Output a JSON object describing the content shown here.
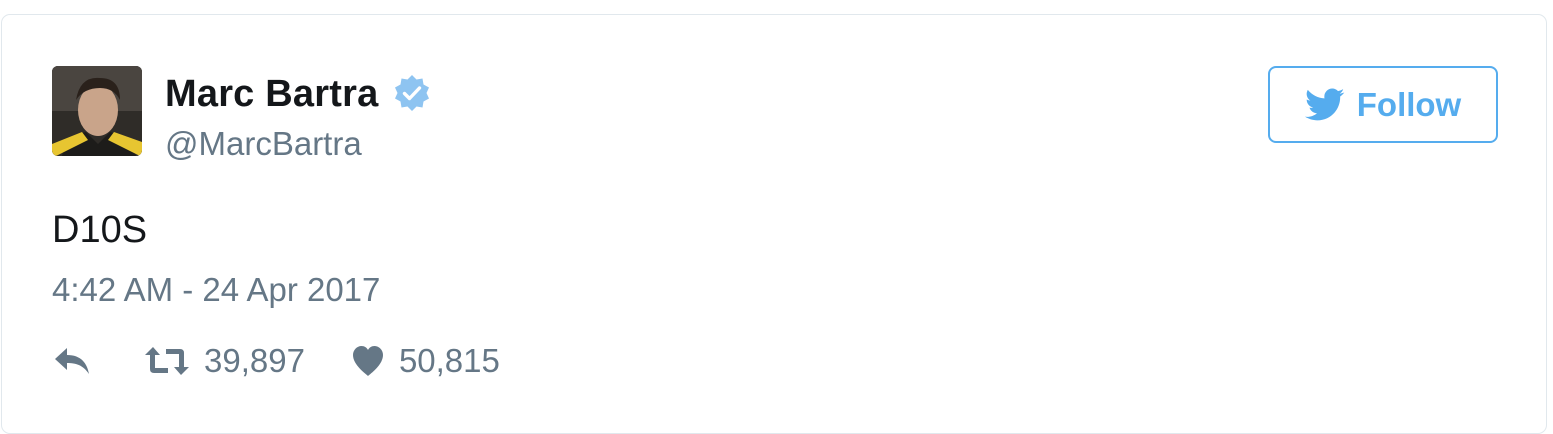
{
  "user": {
    "display_name": "Marc Bartra",
    "screen_name": "@MarcBartra",
    "verified": true
  },
  "follow_button": {
    "label": "Follow",
    "icon": "twitter-bird-icon"
  },
  "tweet": {
    "text": "D10S",
    "timestamp": "4:42 AM - 24 Apr 2017"
  },
  "actions": {
    "reply": {
      "icon": "reply-icon"
    },
    "retweet": {
      "icon": "retweet-icon",
      "count": "39,897"
    },
    "like": {
      "icon": "heart-icon",
      "count": "50,815"
    }
  },
  "colors": {
    "twitter_blue": "#55acee",
    "verified_blue": "#8ec4f1",
    "text_primary": "#14171a",
    "text_secondary": "#657786",
    "border": "#e1e8ed"
  }
}
